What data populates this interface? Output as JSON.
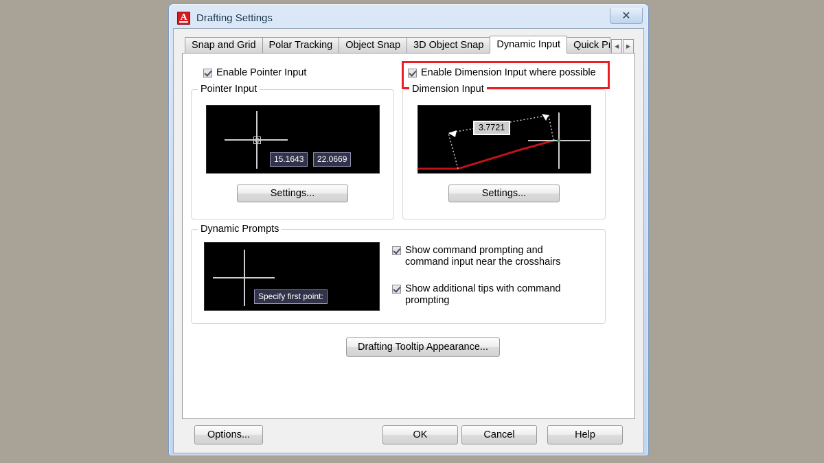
{
  "window": {
    "title": "Drafting Settings",
    "icon": "autocad-a-icon",
    "close_label": "✕"
  },
  "tabs": [
    {
      "label": "Snap and Grid",
      "active": false
    },
    {
      "label": "Polar Tracking",
      "active": false
    },
    {
      "label": "Object Snap",
      "active": false
    },
    {
      "label": "3D Object Snap",
      "active": false
    },
    {
      "label": "Dynamic Input",
      "active": true
    },
    {
      "label": "Quick Pr",
      "active": false
    }
  ],
  "tab_arrows": {
    "prev": "◀",
    "next": "▶"
  },
  "top_checkboxes": {
    "enable_pointer_input": {
      "label": "Enable Pointer Input",
      "checked": true
    },
    "enable_dimension_input": {
      "label": "Enable Dimension Input where possible",
      "checked": true
    }
  },
  "highlight": {
    "color": "#ee1c25",
    "target": "enable-dimension-input-checkbox"
  },
  "pointer_input": {
    "group_title": "Pointer Input",
    "preview": {
      "x_value": "15.1643",
      "y_value": "22.0669"
    },
    "settings_button": "Settings..."
  },
  "dimension_input": {
    "group_title": "Dimension Input",
    "preview": {
      "dimension_value": "3.7721",
      "geometry_color": "#c0121a"
    },
    "settings_button": "Settings..."
  },
  "dynamic_prompts": {
    "group_title": "Dynamic Prompts",
    "preview": {
      "prompt_text": "Specify first point:"
    },
    "checkboxes": [
      {
        "label": "Show command prompting and command input near the crosshairs",
        "checked": true
      },
      {
        "label": "Show additional tips with command prompting",
        "checked": true
      }
    ]
  },
  "tooltip_appearance_button": "Drafting Tooltip Appearance...",
  "footer_buttons": {
    "options": "Options...",
    "ok": "OK",
    "cancel": "Cancel",
    "help": "Help"
  }
}
